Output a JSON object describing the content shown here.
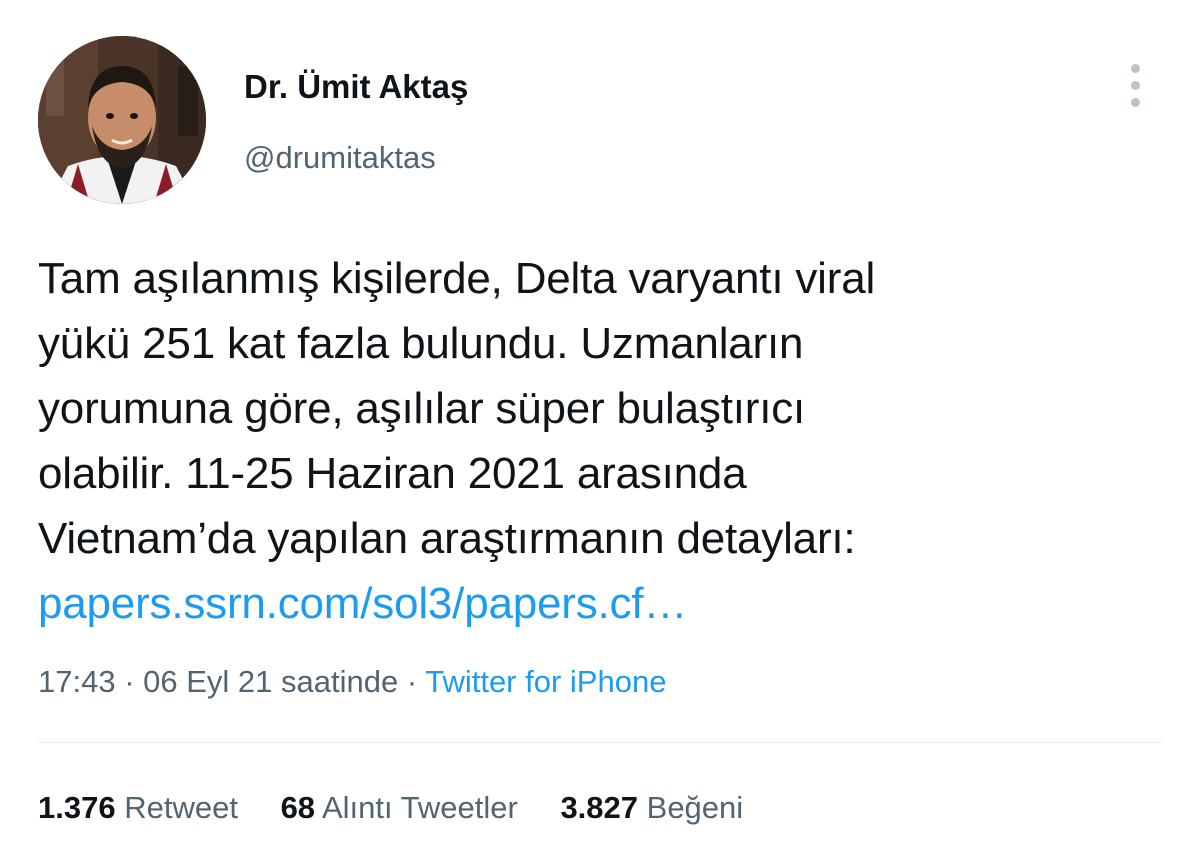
{
  "author": {
    "display_name": "Dr. Ümit Aktaş",
    "handle": "@drumitaktas"
  },
  "tweet": {
    "text_lines": [
      "Tam aşılanmış kişilerde, Delta varyantı viral",
      "yükü 251 kat fazla bulundu. Uzmanların",
      "yorumuna göre, aşılılar süper bulaştırıcı",
      "olabilir. 11-25 Haziran 2021 arasında",
      "Vietnam’da yapılan araştırmanın detayları:"
    ],
    "link": "papers.ssrn.com/sol3/papers.cf…"
  },
  "meta": {
    "time": "17:43",
    "sep1": " · ",
    "date": "06 Eyl 21 saatinde",
    "sep2": " · ",
    "source": "Twitter for iPhone"
  },
  "stats": {
    "retweets_count": "1.376",
    "retweets_label": "Retweet",
    "quotes_count": "68",
    "quotes_label": "Alıntı Tweetler",
    "likes_count": "3.827",
    "likes_label": "Beğeni"
  },
  "icons": {
    "more": "more-vertical-icon"
  },
  "colors": {
    "link": "#1d9bf0",
    "secondary_text": "#536471",
    "primary_text": "#0f1419"
  }
}
